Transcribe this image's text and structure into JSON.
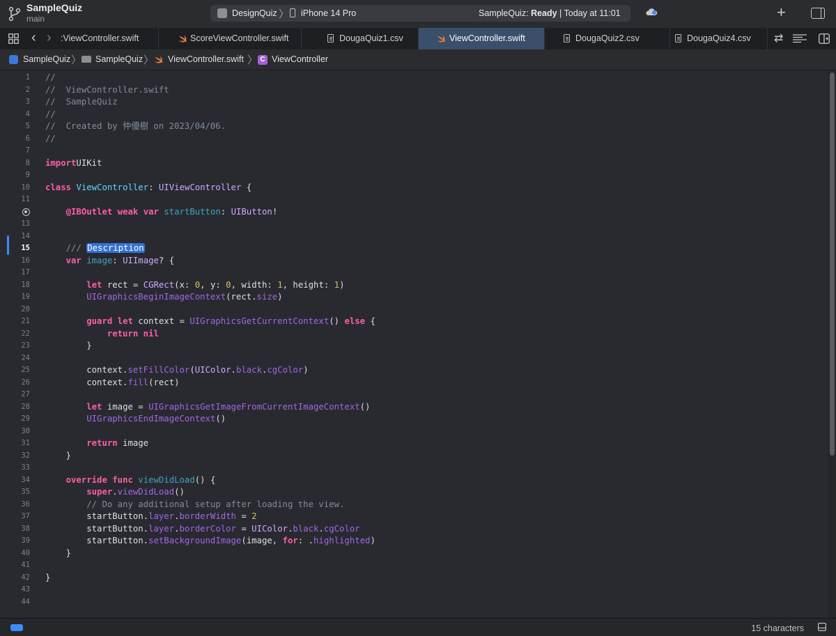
{
  "title": {
    "project": "SampleQuiz",
    "branch": "main",
    "scheme": "DesignQuiz",
    "device": "iPhone 14 Pro",
    "status_project": "SampleQuiz: ",
    "status_state": "Ready",
    "status_time": " | Today at 11:01"
  },
  "tabs": [
    {
      "label": ":ViewController.swift",
      "kind": "swift",
      "active": false
    },
    {
      "label": "ScoreViewController.swift",
      "kind": "swift",
      "active": false
    },
    {
      "label": "DougaQuiz1.csv",
      "kind": "csv",
      "active": false
    },
    {
      "label": "ViewController.swift",
      "kind": "swift",
      "active": true
    },
    {
      "label": "DougaQuiz2.csv",
      "kind": "csv",
      "active": false
    },
    {
      "label": "DougaQuiz4.csv",
      "kind": "csv",
      "active": false
    }
  ],
  "breadcrumb": {
    "project": "SampleQuiz",
    "folder": "SampleQuiz",
    "file": "ViewController.swift",
    "class_badge": "C",
    "symbol": "ViewController"
  },
  "editor": {
    "current_line": 15,
    "outlet_line": 12,
    "lines": [
      [
        [
          "cm",
          "//"
        ]
      ],
      [
        [
          "cm",
          "//  ViewController.swift"
        ]
      ],
      [
        [
          "cm",
          "//  SampleQuiz"
        ]
      ],
      [
        [
          "cm",
          "//"
        ]
      ],
      [
        [
          "cm",
          "//  Created by 仲優樹 on 2023/04/06."
        ]
      ],
      [
        [
          "cm",
          "//"
        ]
      ],
      [],
      [
        [
          "kw",
          "import"
        ],
        [
          "",
          "UIKit"
        ]
      ],
      [],
      [
        [
          "kw",
          "class"
        ],
        [
          "",
          " "
        ],
        [
          "tdecl",
          "ViewController"
        ],
        [
          "",
          ": "
        ],
        [
          "ty",
          "UIViewController"
        ],
        [
          "",
          " {"
        ]
      ],
      [],
      [
        [
          "",
          "    "
        ],
        [
          "kw",
          "@IBOutlet"
        ],
        [
          "",
          " "
        ],
        [
          "kw",
          "weak"
        ],
        [
          "",
          " "
        ],
        [
          "kw",
          "var"
        ],
        [
          "",
          " "
        ],
        [
          "vdecl",
          "startButton"
        ],
        [
          "",
          ": "
        ],
        [
          "ty",
          "UIButton"
        ],
        [
          "",
          "!"
        ]
      ],
      [],
      [],
      [
        [
          "",
          "    "
        ],
        [
          "cm",
          "/// "
        ],
        [
          "sel",
          "Description"
        ]
      ],
      [
        [
          "",
          "    "
        ],
        [
          "kw",
          "var"
        ],
        [
          "",
          " "
        ],
        [
          "vdecl",
          "image"
        ],
        [
          "",
          ": "
        ],
        [
          "ty",
          "UIImage"
        ],
        [
          "",
          "? {"
        ]
      ],
      [],
      [
        [
          "",
          "        "
        ],
        [
          "kw",
          "let"
        ],
        [
          "",
          " rect = "
        ],
        [
          "ty",
          "CGRect"
        ],
        [
          "",
          "(x: "
        ],
        [
          "num",
          "0"
        ],
        [
          "",
          ", y: "
        ],
        [
          "num",
          "0"
        ],
        [
          "",
          ", width: "
        ],
        [
          "num",
          "1"
        ],
        [
          "",
          ", height: "
        ],
        [
          "num",
          "1"
        ],
        [
          "",
          ")"
        ]
      ],
      [
        [
          "",
          "        "
        ],
        [
          "fn",
          "UIGraphicsBeginImageContext"
        ],
        [
          "",
          "(rect."
        ],
        [
          "fn",
          "size"
        ],
        [
          "",
          ")"
        ]
      ],
      [],
      [
        [
          "",
          "        "
        ],
        [
          "kw",
          "guard"
        ],
        [
          "",
          " "
        ],
        [
          "kw",
          "let"
        ],
        [
          "",
          " context = "
        ],
        [
          "fn",
          "UIGraphicsGetCurrentContext"
        ],
        [
          "",
          "() "
        ],
        [
          "kw",
          "else"
        ],
        [
          "",
          " {"
        ]
      ],
      [
        [
          "",
          "            "
        ],
        [
          "kw",
          "return"
        ],
        [
          "",
          " "
        ],
        [
          "kw",
          "nil"
        ]
      ],
      [
        [
          "",
          "        }"
        ]
      ],
      [],
      [
        [
          "",
          "        context."
        ],
        [
          "fn",
          "setFillColor"
        ],
        [
          "",
          "("
        ],
        [
          "ty",
          "UIColor"
        ],
        [
          "",
          "."
        ],
        [
          "fn",
          "black"
        ],
        [
          "",
          "."
        ],
        [
          "fn",
          "cgColor"
        ],
        [
          "",
          ")"
        ]
      ],
      [
        [
          "",
          "        context."
        ],
        [
          "fn",
          "fill"
        ],
        [
          "",
          "(rect)"
        ]
      ],
      [],
      [
        [
          "",
          "        "
        ],
        [
          "kw",
          "let"
        ],
        [
          "",
          " image = "
        ],
        [
          "fn",
          "UIGraphicsGetImageFromCurrentImageContext"
        ],
        [
          "",
          "()"
        ]
      ],
      [
        [
          "",
          "        "
        ],
        [
          "fn",
          "UIGraphicsEndImageContext"
        ],
        [
          "",
          "()"
        ]
      ],
      [],
      [
        [
          "",
          "        "
        ],
        [
          "kw",
          "return"
        ],
        [
          "",
          " image"
        ]
      ],
      [
        [
          "",
          "    }"
        ]
      ],
      [],
      [
        [
          "",
          "    "
        ],
        [
          "kw",
          "override"
        ],
        [
          "",
          " "
        ],
        [
          "kw",
          "func"
        ],
        [
          "",
          " "
        ],
        [
          "vdecl",
          "viewDidLoad"
        ],
        [
          "",
          "() {"
        ]
      ],
      [
        [
          "",
          "        "
        ],
        [
          "kw",
          "super"
        ],
        [
          "",
          "."
        ],
        [
          "fn",
          "viewDidLoad"
        ],
        [
          "",
          "()"
        ]
      ],
      [
        [
          "",
          "        "
        ],
        [
          "cm",
          "// Do any additional setup after loading the view."
        ]
      ],
      [
        [
          "",
          "        startButton."
        ],
        [
          "fn",
          "layer"
        ],
        [
          "",
          "."
        ],
        [
          "fn",
          "borderWidth"
        ],
        [
          "",
          " = "
        ],
        [
          "num",
          "2"
        ]
      ],
      [
        [
          "",
          "        startButton."
        ],
        [
          "fn",
          "layer"
        ],
        [
          "",
          "."
        ],
        [
          "fn",
          "borderColor"
        ],
        [
          "",
          " = "
        ],
        [
          "ty",
          "UIColor"
        ],
        [
          "",
          "."
        ],
        [
          "fn",
          "black"
        ],
        [
          "",
          "."
        ],
        [
          "fn",
          "cgColor"
        ]
      ],
      [
        [
          "",
          "        startButton."
        ],
        [
          "fn",
          "setBackgroundImage"
        ],
        [
          "",
          "(image, "
        ],
        [
          "kw",
          "for"
        ],
        [
          "",
          ": ."
        ],
        [
          "fn",
          "highlighted"
        ],
        [
          "",
          ")"
        ]
      ],
      [
        [
          "",
          "    }"
        ]
      ],
      [],
      [
        [
          "",
          "}"
        ]
      ],
      [],
      []
    ]
  },
  "statusbar": {
    "chars": "15 characters"
  },
  "colors": {
    "accent": "#3e8cf7",
    "keyword": "#fc5fa3",
    "comment": "#7f8c98",
    "type": "#d0a8ff",
    "number": "#d0bf69"
  }
}
